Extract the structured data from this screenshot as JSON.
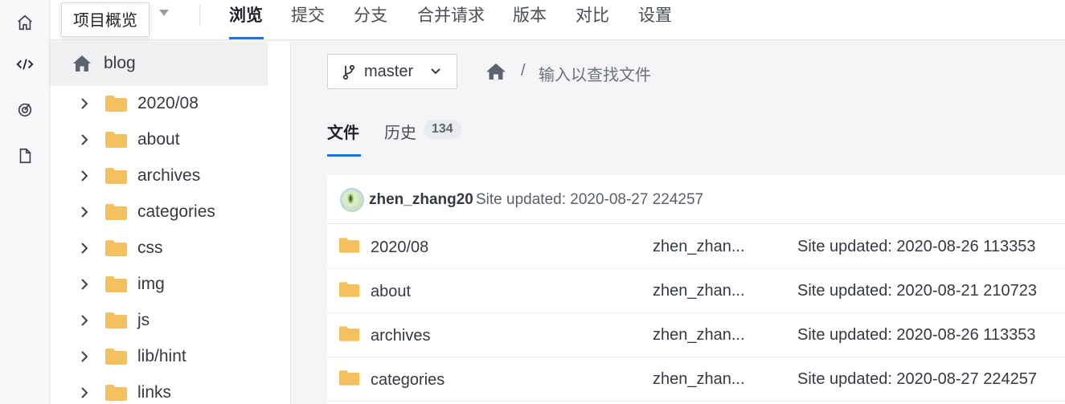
{
  "tooltip": {
    "text": "项目概览"
  },
  "nav": {
    "tabs": [
      {
        "label": "浏览",
        "active": true
      },
      {
        "label": "提交"
      },
      {
        "label": "分支"
      },
      {
        "label": "合并请求"
      },
      {
        "label": "版本"
      },
      {
        "label": "对比"
      },
      {
        "label": "设置"
      }
    ]
  },
  "rail": {
    "items": [
      {
        "icon": "home-icon",
        "active": false
      },
      {
        "icon": "code-icon",
        "active": true
      },
      {
        "icon": "dashboard-icon",
        "active": false
      },
      {
        "icon": "file-icon",
        "active": false
      }
    ]
  },
  "sidebar": {
    "root": {
      "label": "blog",
      "icon": "home-icon"
    },
    "items": [
      {
        "label": "2020/08"
      },
      {
        "label": "about"
      },
      {
        "label": "archives"
      },
      {
        "label": "categories"
      },
      {
        "label": "css"
      },
      {
        "label": "img"
      },
      {
        "label": "js"
      },
      {
        "label": "lib/hint"
      },
      {
        "label": "links"
      }
    ]
  },
  "main": {
    "branch": {
      "label": "master",
      "icon": "branch-icon"
    },
    "breadcrumb": {
      "separator": "/",
      "placeholder": "输入以查找文件"
    },
    "tabs": {
      "files": "文件",
      "history": "历史",
      "history_count": "134"
    },
    "commit": {
      "author": "zhen_zhang20",
      "message": "Site updated: 2020-08-27 224257"
    },
    "files": [
      {
        "name": "2020/08",
        "author": "zhen_zhan...",
        "message": "Site updated: 2020-08-26 113353"
      },
      {
        "name": "about",
        "author": "zhen_zhan...",
        "message": "Site updated: 2020-08-21 210723"
      },
      {
        "name": "archives",
        "author": "zhen_zhan...",
        "message": "Site updated: 2020-08-26 113353"
      },
      {
        "name": "categories",
        "author": "zhen_zhan...",
        "message": "Site updated: 2020-08-27 224257"
      }
    ]
  },
  "colors": {
    "accent": "#1b73e8",
    "folder": "#f5c15e",
    "text": "#343a40"
  }
}
